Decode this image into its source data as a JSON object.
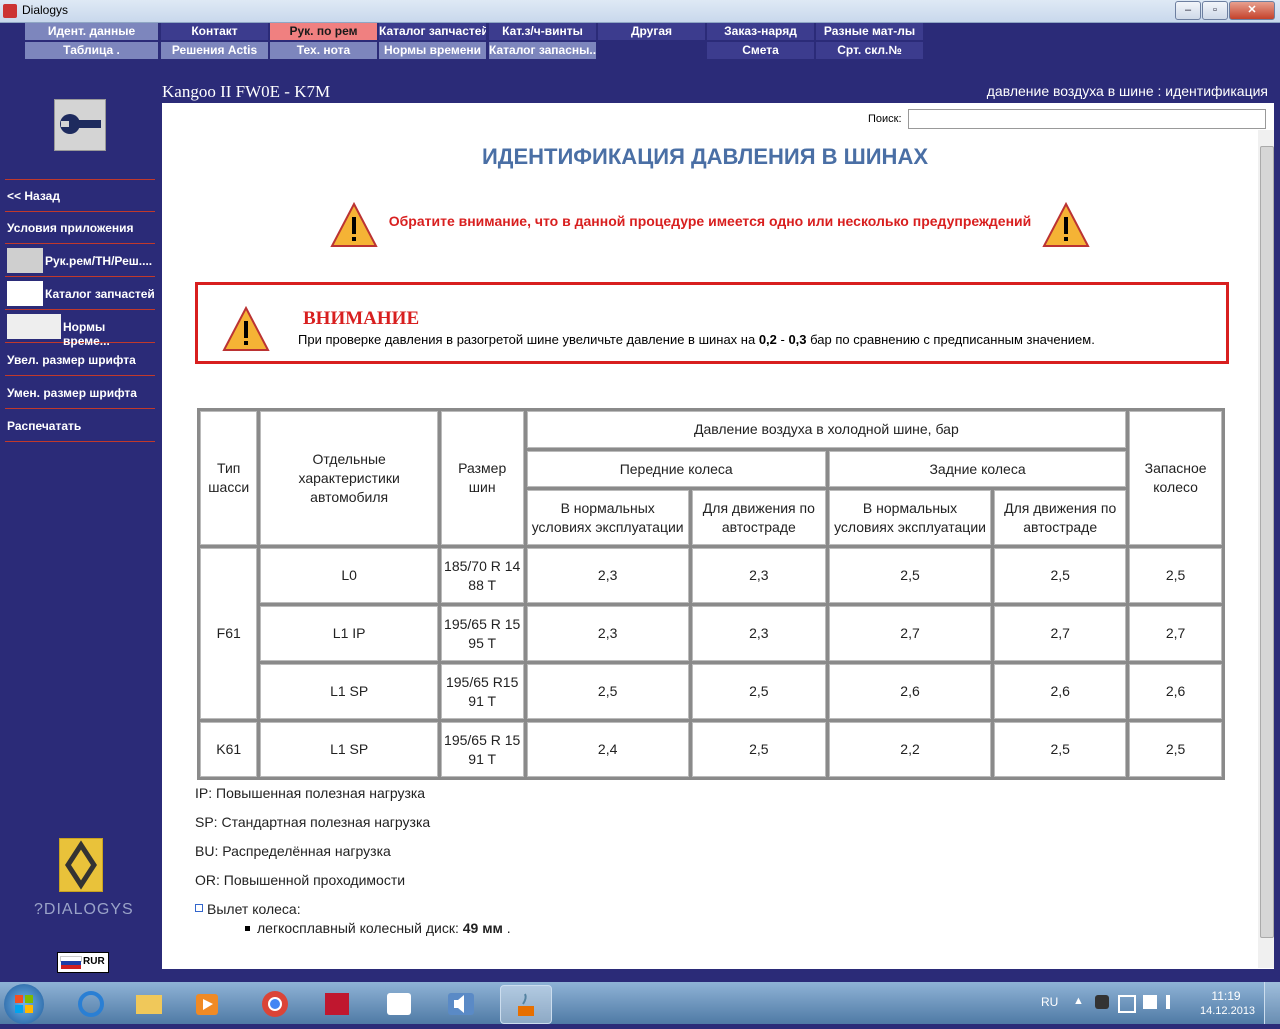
{
  "window": {
    "title": "Dialogys",
    "controls": [
      "–",
      "▫",
      "✕"
    ]
  },
  "menu_row1": [
    "Идент. данные",
    "Контакт",
    "Рук. по рем",
    "Каталог запчастей",
    "Кат.з/ч-винты",
    "Другая",
    "Заказ-наряд",
    "Разные мат-лы"
  ],
  "menu_row2": [
    "Таблица .",
    "Решения Actis",
    "Тех. нота",
    "Нормы времени",
    "Каталог запасны...",
    "",
    "Смета",
    "Срт. скл.№"
  ],
  "header": {
    "model": "Kangoo II FW0E - K7M",
    "subtitle": "давление воздуха в шине : идентификация"
  },
  "sidebar": [
    "<< Назад",
    "Условия приложения",
    "Рук.рем/ТН/Реш....",
    "Каталог запчастей",
    "Нормы време...",
    "Увел. размер шрифта",
    "Умен. размер шрифта",
    "Распечатать"
  ],
  "search": {
    "label": "Поиск:",
    "value": ""
  },
  "doc": {
    "title": "ИДЕНТИФИКАЦИЯ ДАВЛЕНИЯ В ШИНАХ",
    "attention_note": "Обратите внимание, что в данной процедуре имеется одно или несколько предупреждений",
    "warning_title": "ВНИМАНИЕ",
    "warning_text_pre": "При проверке давления в разогретой шине увеличьте давление в шинах на ",
    "warning_val1": "0,2",
    "warning_dash": " - ",
    "warning_val2": "0,3",
    "warning_text_post": " бар по сравнению с предписанным значением."
  },
  "table": {
    "h_chassis": "Тип шасси",
    "h_features": "Отдельные характеристики автомобиля",
    "h_size": "Размер шин",
    "h_cold": "Давление воздуха в холодной шине, бар",
    "h_front": "Передние колеса",
    "h_rear": "Задние колеса",
    "h_spare": "Запасное колесо",
    "h_normal": "В нормальных условиях эксплуатации",
    "h_highway": "Для движения по автостраде",
    "rows": [
      {
        "chassis": "F61",
        "feature": "L0",
        "size": "185/70 R 14 88 T",
        "fn": "2,3",
        "fh": "2,3",
        "rn": "2,5",
        "rh": "2,5",
        "spare": "2,5"
      },
      {
        "chassis": "",
        "feature": "L1 IP",
        "size": "195/65 R 15 95 T",
        "fn": "2,3",
        "fh": "2,3",
        "rn": "2,7",
        "rh": "2,7",
        "spare": "2,7"
      },
      {
        "chassis": "",
        "feature": "L1 SP",
        "size": "195/65 R15 91 T",
        "fn": "2,5",
        "fh": "2,5",
        "rn": "2,6",
        "rh": "2,6",
        "spare": "2,6"
      },
      {
        "chassis": "K61",
        "feature": "L1 SP",
        "size": "195/65 R 15 91 T",
        "fn": "2,4",
        "fh": "2,5",
        "rn": "2,2",
        "rh": "2,5",
        "spare": "2,5"
      }
    ]
  },
  "notes": [
    "IP: Повышенная полезная нагрузка",
    "SP: Стандартная полезная нагрузка",
    "BU: Распределённая нагрузка",
    "OR: Повышенной проходимости"
  ],
  "offset": {
    "label": "Вылет колеса:",
    "item_pre": "легкосплавный колесный диск: ",
    "item_val": "49 мм",
    "item_post": " ."
  },
  "brand": {
    "logo_text": "DIALOGYS",
    "currency": "RUR"
  },
  "taskbar": {
    "lang": "RU",
    "time": "11:19",
    "date": "14.12.2013"
  },
  "colors": {
    "background": "#2b2b78",
    "menu": "#3c3c8e",
    "menu_active": "#f08080",
    "title": "#4a6fa5",
    "warning": "#d81f1f"
  }
}
